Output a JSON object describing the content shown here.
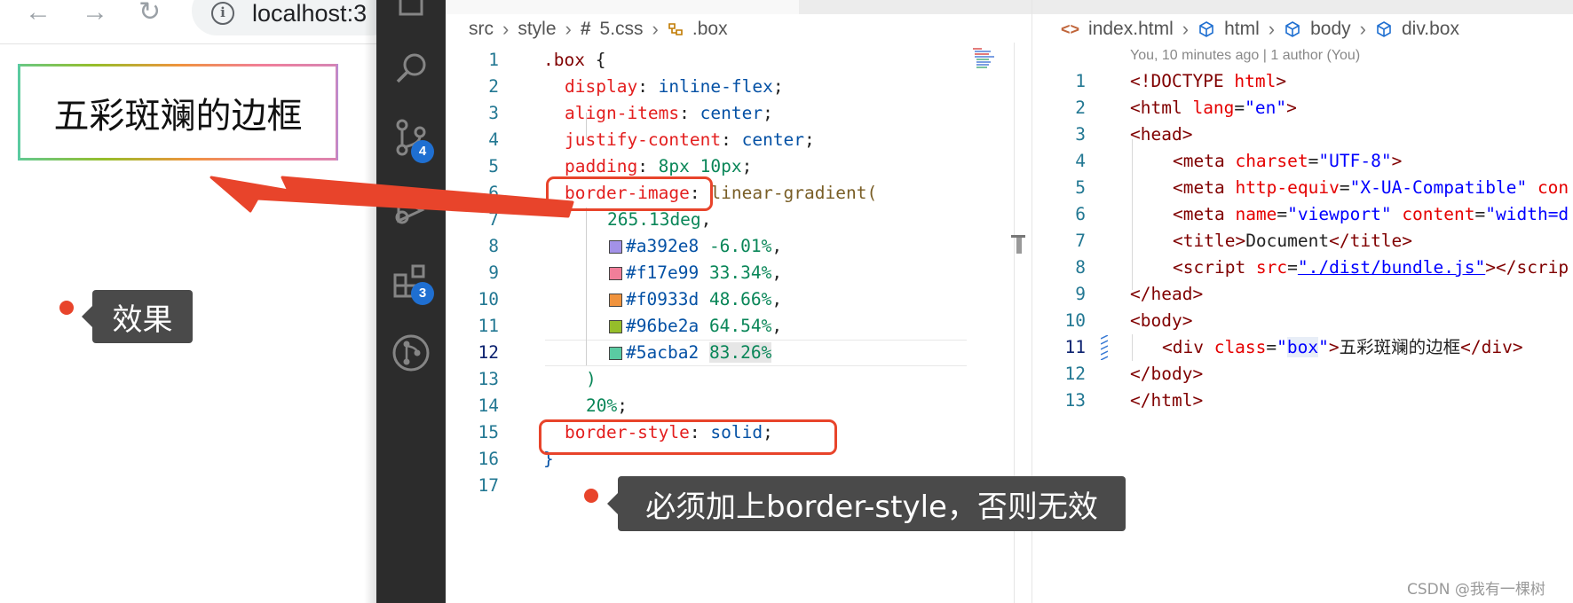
{
  "browser": {
    "back": "←",
    "forward": "→",
    "reload": "↻",
    "info": "i",
    "url": "localhost:3",
    "box_text": "五彩斑斓的边框"
  },
  "colors": {
    "gradient": [
      "#a392e8",
      "#f17e99",
      "#f0933d",
      "#96be2a",
      "#5acba2"
    ],
    "annotation_red": "#e8442b",
    "tooltip_bg": "#4a4a4a",
    "activity_bg": "#2c2c2c",
    "badge_blue": "#1f6fd1"
  },
  "activity_bar": {
    "icons": [
      "files-icon",
      "search-icon",
      "source-control-icon",
      "debug-icon",
      "extensions-icon",
      "git-graph-icon"
    ],
    "source_control_badge": "4",
    "extensions_badge": "3"
  },
  "editor_css": {
    "breadcrumb": [
      "src",
      "style",
      "#",
      "5.css",
      ".box"
    ],
    "line_numbers": [
      "1",
      "2",
      "3",
      "4",
      "5",
      "6",
      "7",
      "8",
      "9",
      "10",
      "11",
      "12",
      "13",
      "14",
      "15",
      "16",
      "17"
    ],
    "lines": {
      "l1_sel": ".box",
      "l1_brace": " {",
      "l2_prop": "display",
      "l2_val": "inline-flex",
      "l3_prop": "align-items",
      "l3_val": "center",
      "l4_prop": "justify-content",
      "l4_val": "center",
      "l5_prop": "padding",
      "l5_val": "8px 10px",
      "l6_prop": "border-image",
      "l6_fn": "linear-gradient(",
      "l7_val": "265.13deg",
      "stops": [
        {
          "hex": "#a392e8",
          "pct": "-6.01%",
          "end": ","
        },
        {
          "hex": "#f17e99",
          "pct": "33.34%",
          "end": ","
        },
        {
          "hex": "#f0933d",
          "pct": "48.66%",
          "end": ","
        },
        {
          "hex": "#96be2a",
          "pct": "64.54%",
          "end": ","
        },
        {
          "hex": "#5acba2",
          "pct": "83.26%",
          "end": ""
        }
      ],
      "l13": ")",
      "l14_val": "20%",
      "l15_prop": "border-style",
      "l15_val": "solid",
      "l16": "}"
    }
  },
  "editor_html": {
    "breadcrumb": [
      "<>",
      "index.html",
      "html",
      "body",
      "div.box"
    ],
    "blame": "You, 10 minutes ago | 1 author (You)",
    "line_numbers": [
      "1",
      "2",
      "3",
      "4",
      "5",
      "6",
      "7",
      "8",
      "9",
      "10",
      "11",
      "12",
      "13"
    ],
    "l1": {
      "a": "<!DOCTYPE ",
      "b": "html",
      "c": ">"
    },
    "l2": {
      "a": "<html ",
      "b": "lang",
      "c": "=",
      "d": "\"en\"",
      "e": ">"
    },
    "l3": "<head>",
    "l4": {
      "a": "<meta ",
      "b": "charset",
      "c": "=",
      "d": "\"UTF-8\"",
      "e": ">"
    },
    "l5": {
      "a": "<meta ",
      "b": "http-equiv",
      "c": "=",
      "d": "\"X-UA-Compatible\"",
      "e": " con"
    },
    "l6": {
      "a": "<meta ",
      "b": "name",
      "c": "=",
      "d": "\"viewport\"",
      "e": " content",
      "f": "=",
      "g": "\"width=d"
    },
    "l7": {
      "a": "<title>",
      "b": "Document",
      "c": "</title>"
    },
    "l8": {
      "a": "<script ",
      "b": "src",
      "c": "=",
      "d": "\"./dist/bundle.js\"",
      "e": "></scrip"
    },
    "l9": "</head>",
    "l10": "<body>",
    "l11": {
      "a": "<div ",
      "b": "class",
      "c": "=",
      "d": "\"",
      "e": "box",
      "f": "\"",
      "g": ">",
      "h": "五彩斑斓的边框",
      "i": "</div>"
    },
    "l12": "</body>",
    "l13": "</html>"
  },
  "annotations": {
    "effect_label": "效果",
    "must_label": "必须加上border-style，否则无效"
  },
  "watermark": "CSDN @我有一棵树"
}
